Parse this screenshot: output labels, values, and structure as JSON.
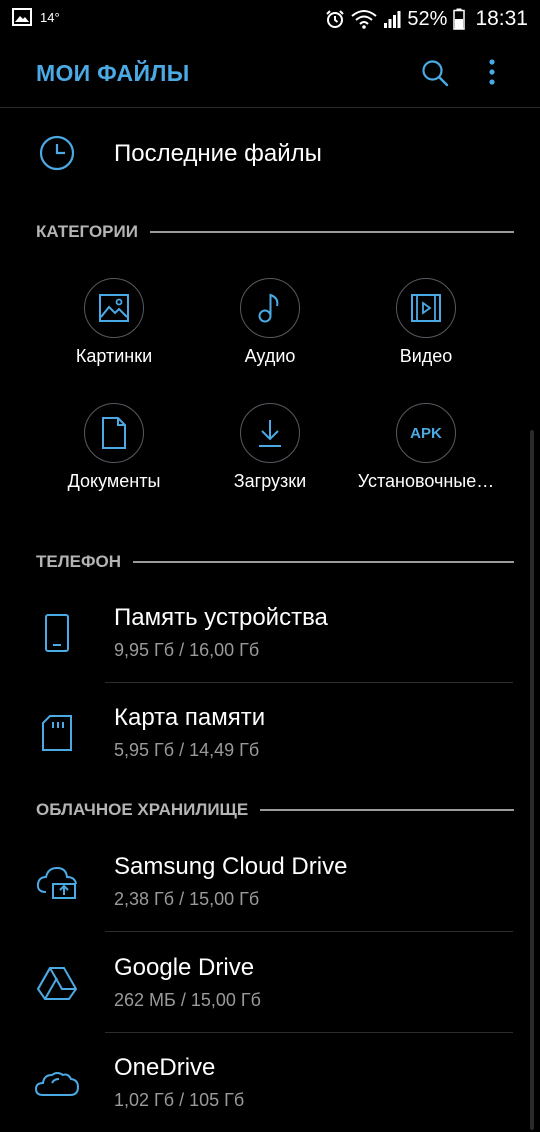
{
  "status_bar": {
    "temperature": "14°",
    "battery": "52%",
    "time": "18:31"
  },
  "app_bar": {
    "title": "МОИ ФАЙЛЫ"
  },
  "recent": {
    "label": "Последние файлы"
  },
  "sections": {
    "categories": "КАТЕГОРИИ",
    "phone": "ТЕЛЕФОН",
    "cloud": "ОБЛАЧНОЕ ХРАНИЛИЩЕ"
  },
  "categories": [
    {
      "label": "Картинки",
      "icon": "image-icon"
    },
    {
      "label": "Аудио",
      "icon": "music-note-icon"
    },
    {
      "label": "Видео",
      "icon": "video-icon"
    },
    {
      "label": "Документы",
      "icon": "document-icon"
    },
    {
      "label": "Загрузки",
      "icon": "download-icon"
    },
    {
      "label": "Установочные…",
      "icon": "apk-icon",
      "icon_text": "APK"
    }
  ],
  "phone_storage": [
    {
      "title": "Память устройства",
      "usage": "9,95 Гб / 16,00 Гб",
      "icon": "phone-icon"
    },
    {
      "title": "Карта памяти",
      "usage": "5,95 Гб / 14,49 Гб",
      "icon": "sd-card-icon"
    }
  ],
  "cloud_storage": [
    {
      "title": "Samsung Cloud Drive",
      "usage": "2,38 Гб / 15,00 Гб",
      "icon": "samsung-cloud-icon"
    },
    {
      "title": "Google Drive",
      "usage": "262 МБ / 15,00 Гб",
      "icon": "google-drive-icon"
    },
    {
      "title": "OneDrive",
      "usage": "1,02 Гб / 105 Гб",
      "icon": "onedrive-icon"
    }
  ],
  "colors": {
    "accent": "#4ba9e4",
    "background": "#000000",
    "section_text": "#b4b4b4",
    "secondary_text": "#9a9a9a"
  }
}
